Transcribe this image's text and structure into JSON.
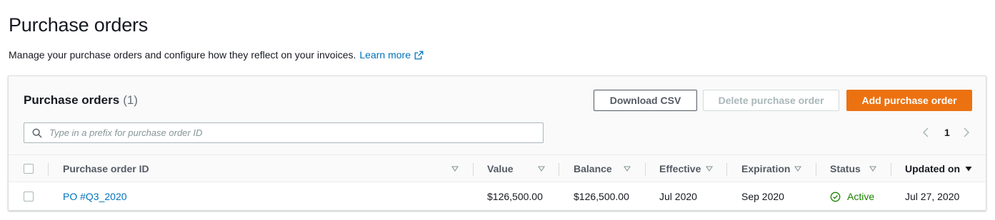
{
  "page": {
    "title": "Purchase orders",
    "description": "Manage your purchase orders and configure how they reflect on your invoices.",
    "learn_more": "Learn more"
  },
  "card": {
    "title": "Purchase orders",
    "count": "(1)",
    "buttons": {
      "download_csv": "Download CSV",
      "delete": "Delete purchase order",
      "add": "Add purchase order"
    },
    "search": {
      "placeholder": "Type in a prefix for purchase order ID",
      "value": ""
    },
    "pagination": {
      "current_page": "1"
    }
  },
  "table": {
    "columns": {
      "id": "Purchase order ID",
      "value": "Value",
      "balance": "Balance",
      "effective": "Effective",
      "expiration": "Expiration",
      "status": "Status",
      "updated": "Updated on"
    },
    "rows": [
      {
        "id": "PO #Q3_2020",
        "value": "$126,500.00",
        "balance": "$126,500.00",
        "effective": "Jul 2020",
        "expiration": "Sep 2020",
        "status": "Active",
        "updated": "Jul 27, 2020"
      }
    ]
  },
  "colors": {
    "primary_button": "#ec7211",
    "link": "#0073bb",
    "status_active": "#1d8102"
  },
  "icons": {
    "external_link": "external-link-icon",
    "search": "search-icon",
    "sort": "caret-down-outline-icon",
    "sort_active": "caret-down-filled-icon",
    "status": "check-circle-icon",
    "prev": "chevron-left-icon",
    "next": "chevron-right-icon"
  }
}
